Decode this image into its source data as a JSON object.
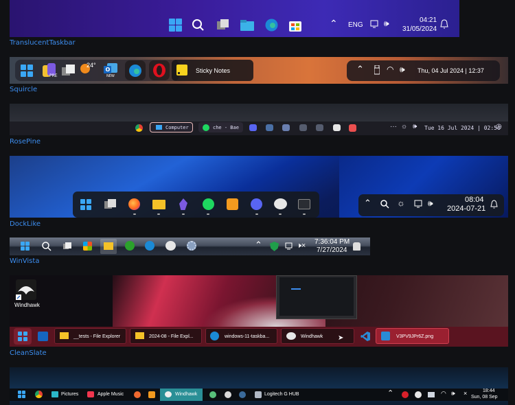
{
  "themes": [
    {
      "name": "TranslucentTaskbar",
      "lang": "ENG",
      "time": "04:21",
      "date": "31/05/2024"
    },
    {
      "name": "Squircle",
      "pinned_app": "Sticky Notes",
      "weather_temp": "24°",
      "datetime": "Thu, 04 Jul 2024 | 12:37"
    },
    {
      "name": "RosePine",
      "app1": "Computer",
      "app2": "che - Bae",
      "datetime": "Tue 16 Jul 2024 | 02:56"
    },
    {
      "name": "DockLike",
      "time": "08:04",
      "date": "2024-07-21"
    },
    {
      "name": "WinVista",
      "time": "7:36:04 PM",
      "date": "7/27/2024"
    },
    {
      "name": "CleanSlate",
      "desktop_icon": "Windhawk",
      "tasks": [
        "__tests - File Explorer",
        "2024-08 - File Expl...",
        "windows-11-taskba...",
        "Windhawk",
        "V3PV9JPr6Z.png"
      ]
    },
    {
      "name": "",
      "tasks": [
        "Pictures",
        "Apple Music",
        "Windhawk",
        "Logitech G HUB"
      ],
      "time": "18:44",
      "date": "Sun, 08 Sep"
    }
  ],
  "colors": {
    "label": "#3d8ef0",
    "windows_blue": "#3aa7f5"
  }
}
